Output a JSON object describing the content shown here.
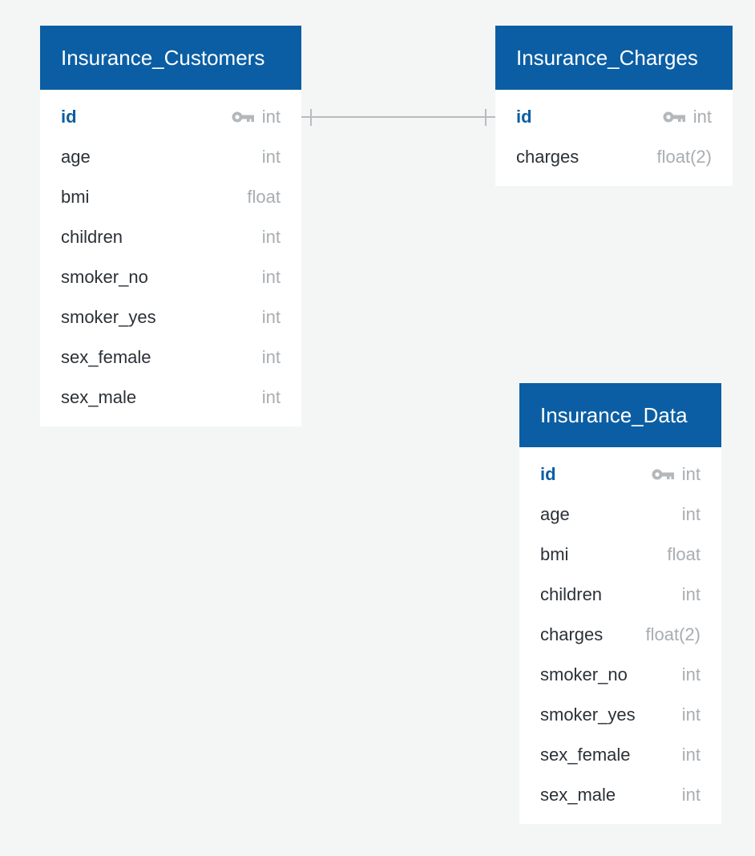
{
  "colors": {
    "background": "#f4f6f6",
    "header": "#0b5ea3",
    "primary_key_text": "#0b5ea3",
    "column_text": "#2b3137",
    "type_text": "#a8adb1",
    "relation_line": "#b8bcbf"
  },
  "tables": [
    {
      "name": "Insurance_Customers",
      "columns": [
        {
          "name": "id",
          "type": "int",
          "pk": true
        },
        {
          "name": "age",
          "type": "int"
        },
        {
          "name": "bmi",
          "type": "float"
        },
        {
          "name": "children",
          "type": "int"
        },
        {
          "name": "smoker_no",
          "type": "int"
        },
        {
          "name": "smoker_yes",
          "type": "int"
        },
        {
          "name": "sex_female",
          "type": "int"
        },
        {
          "name": "sex_male",
          "type": "int"
        }
      ]
    },
    {
      "name": "Insurance_Charges",
      "columns": [
        {
          "name": "id",
          "type": "int",
          "pk": true
        },
        {
          "name": "charges",
          "type": "float(2)"
        }
      ]
    },
    {
      "name": "Insurance_Data",
      "columns": [
        {
          "name": "id",
          "type": "int",
          "pk": true
        },
        {
          "name": "age",
          "type": "int"
        },
        {
          "name": "bmi",
          "type": "float"
        },
        {
          "name": "children",
          "type": "int"
        },
        {
          "name": "charges",
          "type": "float(2)"
        },
        {
          "name": "smoker_no",
          "type": "int"
        },
        {
          "name": "smoker_yes",
          "type": "int"
        },
        {
          "name": "sex_female",
          "type": "int"
        },
        {
          "name": "sex_male",
          "type": "int"
        }
      ]
    }
  ],
  "relations": [
    {
      "from": "Insurance_Customers.id",
      "to": "Insurance_Charges.id",
      "type": "one-to-one",
      "line_icon": "one-to-one-connector"
    }
  ]
}
